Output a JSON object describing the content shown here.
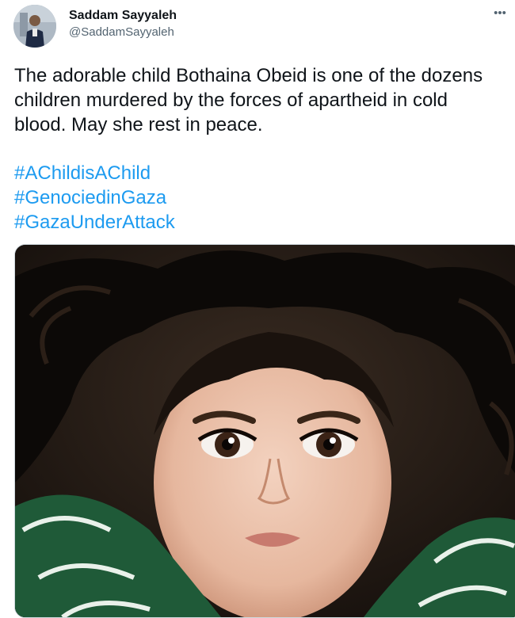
{
  "author": {
    "display_name": "Saddam Sayyaleh",
    "handle": "@SaddamSayyaleh"
  },
  "tweet": {
    "text_lines": [
      "The adorable child Bothaina Obeid is one of the dozens",
      "children murdered by the forces of apartheid in cold",
      "blood. May she rest in peace."
    ],
    "hashtags": [
      "#AChildisAChild",
      "#GenociedinGaza",
      "#GazaUnderAttack"
    ]
  },
  "icons": {
    "more": "more-horizontal-icon"
  },
  "colors": {
    "link": "#1d9bf0",
    "text": "#0f1419",
    "secondary": "#536471"
  }
}
